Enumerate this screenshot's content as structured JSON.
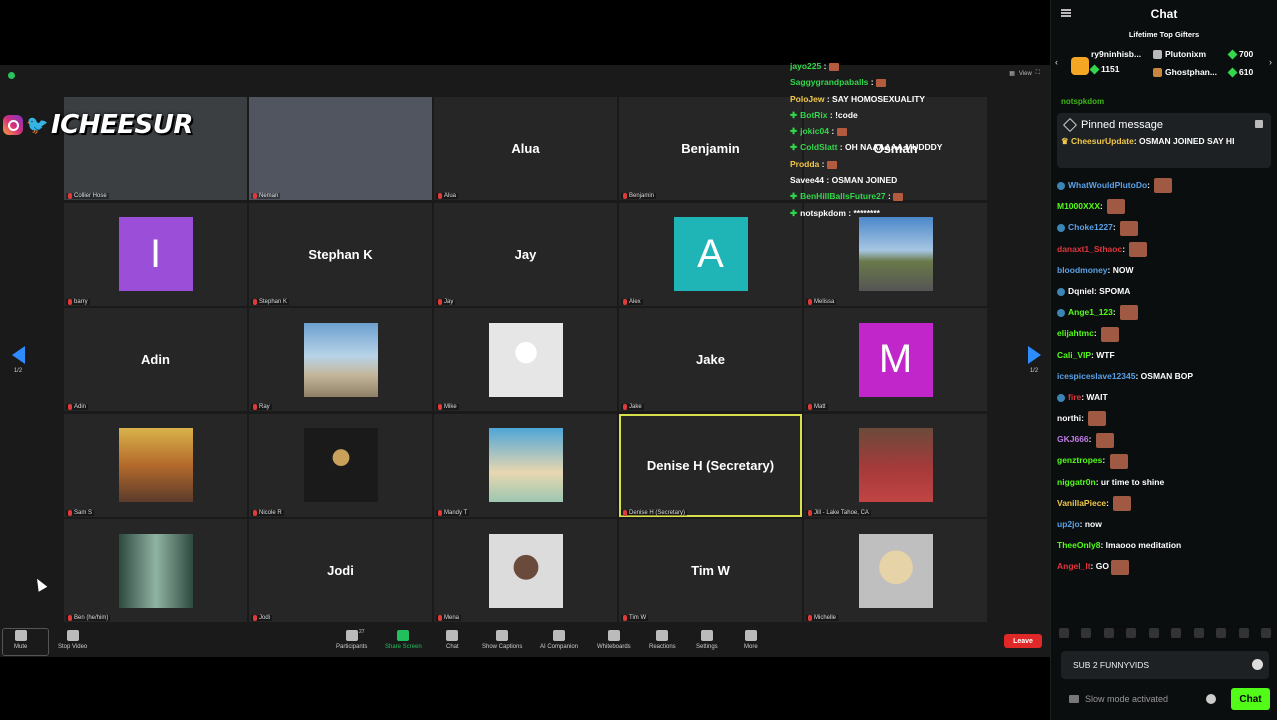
{
  "overlay": {
    "brand": "ICHEESUR"
  },
  "zoom": {
    "view_label": "View",
    "page_indicator": "1/2",
    "tiles": [
      {
        "label": "Collier Hose",
        "kind": "video",
        "bg": "#3b3f42"
      },
      {
        "label": "Neman",
        "kind": "video",
        "bg": "#505560"
      },
      {
        "label": "Alua",
        "kind": "name",
        "center": "Alua"
      },
      {
        "label": "Benjamin",
        "kind": "name",
        "center": "Benjamin"
      },
      {
        "label": "",
        "kind": "name",
        "center": "Osman"
      },
      {
        "label": "barry",
        "kind": "letter",
        "center": "I",
        "color": "#9b4fd8"
      },
      {
        "label": "Stephan K",
        "kind": "name",
        "center": "Stephan K"
      },
      {
        "label": "Jay",
        "kind": "name",
        "center": "Jay"
      },
      {
        "label": "Alex",
        "kind": "letter",
        "center": "A",
        "color": "#1fb5b7"
      },
      {
        "label": "Melissa",
        "kind": "photo",
        "bg": "linear-gradient(#4b87c9 0%,#a7c6e3 45%,#6a7a4a 60%,#555 100%)"
      },
      {
        "label": "Adin",
        "kind": "name",
        "center": "Adin"
      },
      {
        "label": "Ray",
        "kind": "photo",
        "bg": "linear-gradient(#6da0cf 0%,#b8d3e8 45%,#c4b79b 70%,#8e8066 100%)"
      },
      {
        "label": "Mike",
        "kind": "photo",
        "bg": "radial-gradient(circle at 50% 40%,#fff 0 18%,#e6e6e6 19% 100%)"
      },
      {
        "label": "Jake",
        "kind": "name",
        "center": "Jake"
      },
      {
        "label": "Matt",
        "kind": "letter",
        "center": "M",
        "color": "#c026c9"
      },
      {
        "label": "Sam S",
        "kind": "photo",
        "bg": "linear-gradient(#d8b34a,#b46a2c 50%,#5b3b2a)"
      },
      {
        "label": "Nicole R",
        "kind": "photo",
        "bg": "radial-gradient(circle at 50% 40%,#c9a15a 0 14%,#1a1a1a 15% 100%)"
      },
      {
        "label": "Mandy T",
        "kind": "photo",
        "bg": "linear-gradient(#4fa6d8,#e8d7b0 60%,#9cc7b1)"
      },
      {
        "label": "Denise H (Secretary)",
        "kind": "name",
        "center": "Denise H (Secretary)",
        "speaking": true
      },
      {
        "label": "Jill - Lake Tahoe, CA",
        "kind": "photo",
        "bg": "linear-gradient(#6b4a3a,#a63a3a 55%,#c14444)"
      },
      {
        "label": "Ben (he/him)",
        "kind": "photo",
        "bg": "linear-gradient(90deg,#2f4a3f,#8fb3a3 50%,#2f4a3f)"
      },
      {
        "label": "Jodi",
        "kind": "name",
        "center": "Jodi"
      },
      {
        "label": "Mena",
        "kind": "photo",
        "bg": "radial-gradient(circle at 50% 45%,#6a4a3a 0 22%,#dcdcdc 23% 100%)"
      },
      {
        "label": "Tim W",
        "kind": "name",
        "center": "Tim W"
      },
      {
        "label": "Michelle",
        "kind": "photo",
        "bg": "radial-gradient(circle at 50% 45%,#e6d4a8 0 30%,#bfbfbf 31% 100%)"
      }
    ],
    "toolbar": {
      "mute": "Mute",
      "stop_video": "Stop Video",
      "participants": "Participants",
      "participants_count": "27",
      "share_screen": "Share Screen",
      "chat": "Chat",
      "show_captions": "Show Captions",
      "ai_companion": "AI Companion",
      "whiteboards": "Whiteboards",
      "reactions": "Reactions",
      "settings": "Settings",
      "more": "More",
      "leave": "Leave"
    }
  },
  "overlay_chat": [
    {
      "user": "jayo225",
      "color": "#32d74b",
      "text": " : ",
      "emote": true,
      "plus": false
    },
    {
      "user": "Saggygrandpaballs",
      "color": "#32d74b",
      "text": " : ",
      "emote": true,
      "plus": false
    },
    {
      "user": "PoloJew",
      "color": "#f0c74a",
      "text": " : SAY HOMOSEXUALITY",
      "emote": false,
      "plus": false
    },
    {
      "user": "BotRix",
      "color": "#32d74b",
      "text": " : !code",
      "emote": false,
      "plus": true
    },
    {
      "user": "jokic04",
      "color": "#32d74b",
      "text": " : ",
      "emote": true,
      "plus": true
    },
    {
      "user": "ColdSlatt",
      "color": "#32d74b",
      "text": " : OH NAAAAAA MUDDDY",
      "emote": false,
      "plus": true
    },
    {
      "user": "Prodda",
      "color": "#f0c74a",
      "text": " : ",
      "emote": true,
      "plus": false
    },
    {
      "user": "Savee44",
      "color": "#ffffff",
      "text": " : OSMAN JOINED",
      "emote": false,
      "plus": false
    },
    {
      "user": "BenHillBallsFuture27",
      "color": "#32d74b",
      "text": " : ",
      "emote": true,
      "plus": true
    },
    {
      "user": "notspkdom",
      "color": "#ffffff",
      "text": " : ********",
      "emote": false,
      "plus": true
    }
  ],
  "chat": {
    "title": "Chat",
    "gifters_title": "Lifetime Top Gifters",
    "gifters": [
      {
        "name": "ry9ninhisb...",
        "count": "1151"
      },
      {
        "name": "Plutonixm",
        "count": "700"
      },
      {
        "name": "Ghostphan...",
        "count": "610"
      }
    ],
    "scroll_user": "notspkdom",
    "pinned_title": "Pinned message",
    "pinned_user": "CheesurUpdate",
    "pinned_text": ": OSMAN JOINED SAY HI",
    "messages": [
      {
        "user": "WhatWouldPlutoDo",
        "color": "#5aa0e6",
        "text": ": ",
        "emote": true,
        "badge": true
      },
      {
        "user": "M1000XXX",
        "color": "#53fc18",
        "text": ": ",
        "emote": true,
        "badge": false
      },
      {
        "user": "Choke1227",
        "color": "#5aa0e6",
        "text": ": ",
        "emote": true,
        "badge": true
      },
      {
        "user": "danaxt1_Sthaoc",
        "color": "#e0353b",
        "text": ": ",
        "emote": true,
        "badge": false
      },
      {
        "user": "bloodmoney",
        "color": "#5aa0e6",
        "text": ": NOW",
        "emote": false,
        "badge": false
      },
      {
        "user": "Dqniel",
        "color": "#ffffff",
        "text": ": SPOMA",
        "emote": false,
        "badge": true
      },
      {
        "user": "Ange1_123",
        "color": "#53fc18",
        "text": ": ",
        "emote": true,
        "badge": true
      },
      {
        "user": "elijahtmc",
        "color": "#53fc18",
        "text": ": ",
        "emote": true,
        "badge": false
      },
      {
        "user": "Cali_VIP",
        "color": "#53fc18",
        "text": ": WTF",
        "emote": false,
        "badge": false
      },
      {
        "user": "icespiceslave12345",
        "color": "#5aa0e6",
        "text": ": OSMAN BOP",
        "emote": false,
        "badge": false
      },
      {
        "user": "fire",
        "color": "#e0353b",
        "text": ": WAIT",
        "emote": false,
        "badge": true
      },
      {
        "user": "northi",
        "color": "#ffffff",
        "text": ": ",
        "emote": true,
        "badge": false
      },
      {
        "user": "GKJ666",
        "color": "#c07be8",
        "text": ": ",
        "emote": true,
        "badge": false
      },
      {
        "user": "genztropes",
        "color": "#53fc18",
        "text": ": ",
        "emote": true,
        "badge": false
      },
      {
        "user": "niggatr0n",
        "color": "#53fc18",
        "text": ": ur time to shine",
        "emote": false,
        "badge": false
      },
      {
        "user": "VanillaPiece",
        "color": "#f0c74a",
        "text": ": ",
        "emote": true,
        "badge": false
      },
      {
        "user": "up2jo",
        "color": "#5aa0e6",
        "text": ": now",
        "emote": false,
        "badge": false
      },
      {
        "user": "TheeOnly8",
        "color": "#53fc18",
        "text": ": lmaooo meditation",
        "emote": false,
        "badge": false
      },
      {
        "user": "Angel_lt",
        "color": "#e0353b",
        "text": ": GO",
        "emote": true,
        "badge": false
      }
    ],
    "input_value": "SUB 2 FUNNYVIDS",
    "slow_mode": "Slow mode activated",
    "send_label": "Chat"
  }
}
